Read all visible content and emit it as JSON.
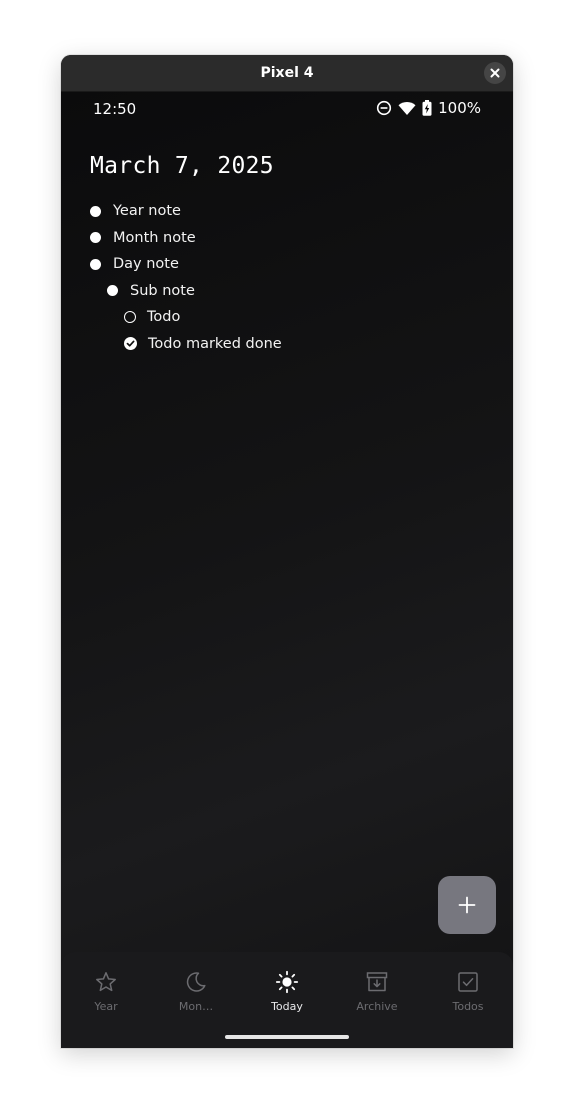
{
  "window": {
    "title": "Pixel 4"
  },
  "status_bar": {
    "time": "12:50",
    "battery_percent": "100%",
    "icons": [
      "do-not-disturb-icon",
      "wifi-icon",
      "battery-charging-icon"
    ]
  },
  "journal": {
    "date": "March 7, 2025",
    "notes": [
      {
        "label": "Year note",
        "kind": "bullet",
        "indent": 0
      },
      {
        "label": "Month note",
        "kind": "bullet",
        "indent": 0
      },
      {
        "label": "Day note",
        "kind": "bullet",
        "indent": 0
      },
      {
        "label": "Sub note",
        "kind": "bullet",
        "indent": 1
      },
      {
        "label": "Todo",
        "kind": "todo",
        "done": false,
        "indent": 2
      },
      {
        "label": "Todo marked done",
        "kind": "todo",
        "done": true,
        "indent": 2
      }
    ]
  },
  "fab": {
    "icon": "plus-icon"
  },
  "bottom_nav": {
    "items": [
      {
        "label": "Year",
        "icon": "star-icon",
        "active": false
      },
      {
        "label": "Mon…",
        "icon": "moon-icon",
        "active": false
      },
      {
        "label": "Today",
        "icon": "sun-icon",
        "active": true
      },
      {
        "label": "Archive",
        "icon": "archive-icon",
        "active": false
      },
      {
        "label": "Todos",
        "icon": "checkbox-icon",
        "active": false
      }
    ]
  },
  "colors": {
    "background": "#0f0f10",
    "text": "#ffffff",
    "fab": "#77777f",
    "nav_background": "#1a1a1c",
    "nav_inactive": "#6c6c70",
    "nav_active": "#e8e8ea"
  }
}
